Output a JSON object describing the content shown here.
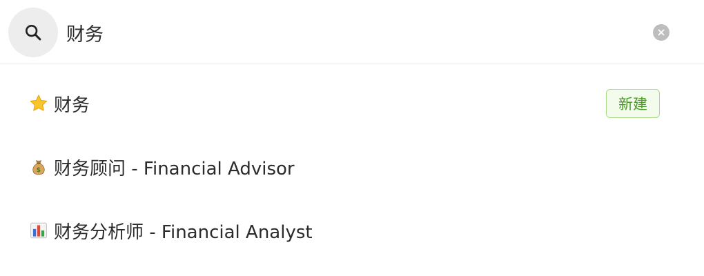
{
  "search": {
    "query": "财务",
    "search_icon": "search-icon",
    "clear_icon": "clear-icon"
  },
  "results": [
    {
      "icon": "star-icon",
      "label": "财务",
      "badge": "新建"
    },
    {
      "icon": "money-bag-icon",
      "label": "财务顾问 - Financial Advisor"
    },
    {
      "icon": "bar-chart-icon",
      "label": "财务分析师 - Financial Analyst"
    }
  ],
  "colors": {
    "badge_border": "#a8dc86",
    "badge_text": "#4c9a2a",
    "badge_bg": "#f3fbec",
    "search_button_bg": "#ededed",
    "clear_button_bg": "#bdbdbd"
  }
}
